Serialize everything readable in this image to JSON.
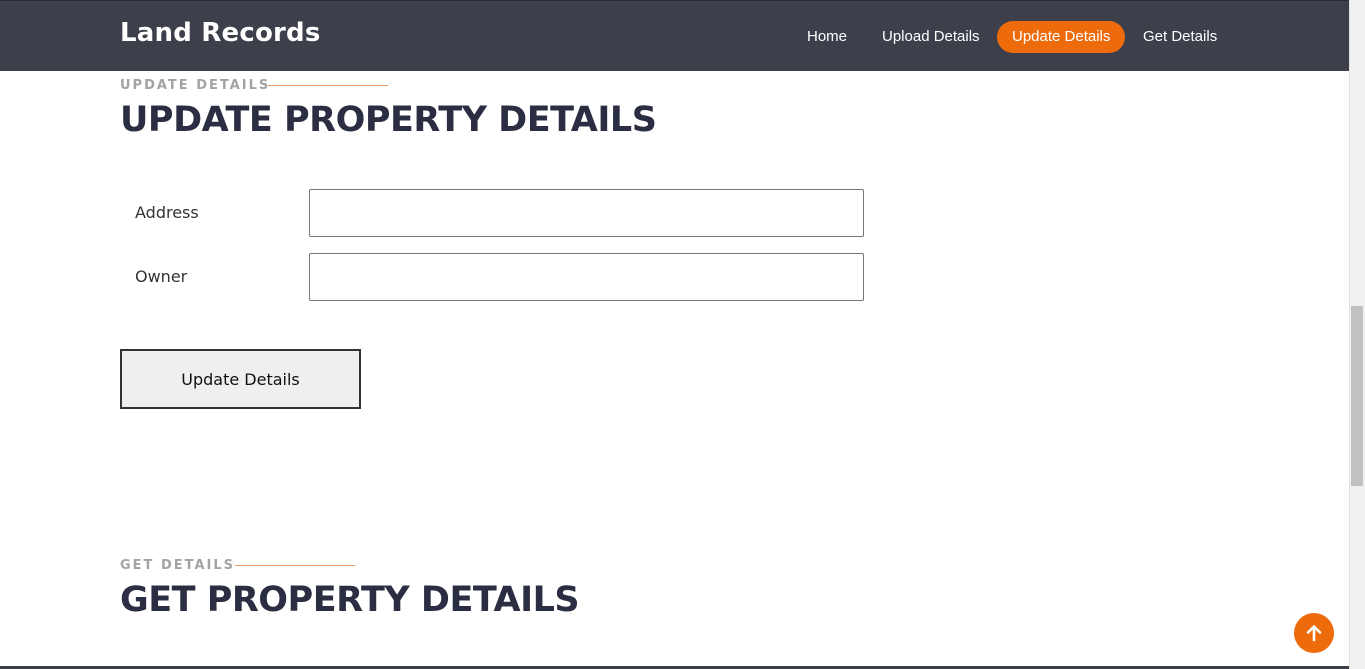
{
  "navbar": {
    "brand": "Land Records",
    "items": [
      {
        "label": "Home",
        "active": false
      },
      {
        "label": "Upload Details",
        "active": false
      },
      {
        "label": "Update Details",
        "active": true
      },
      {
        "label": "Get Details",
        "active": false
      }
    ]
  },
  "update_section": {
    "eyebrow": "UPDATE DETAILS",
    "title": "UPDATE PROPERTY DETAILS",
    "fields": [
      {
        "label": "Address",
        "value": "",
        "placeholder": ""
      },
      {
        "label": "Owner",
        "value": "",
        "placeholder": ""
      }
    ],
    "button_label": "Update Details"
  },
  "get_section": {
    "eyebrow": "GET DETAILS",
    "title": "GET PROPERTY DETAILS"
  },
  "icons": {
    "back_to_top": "arrow-up-icon"
  },
  "colors": {
    "accent": "#ee6b0c",
    "navbar_bg": "#3d404a",
    "heading": "#2b2d42",
    "eyebrow": "#a3a3a3"
  }
}
